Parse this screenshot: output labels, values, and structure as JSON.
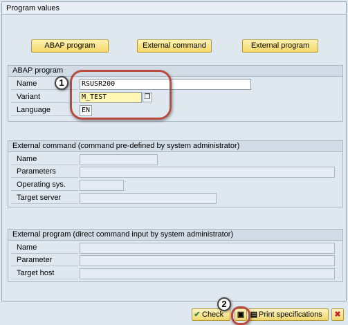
{
  "window": {
    "title": "Program values"
  },
  "buttons": {
    "abap_program": "ABAP program",
    "external_command": "External command",
    "external_program": "External program"
  },
  "abap_group": {
    "title": "ABAP program",
    "name_label": "Name",
    "name_value": "RSUSR200",
    "variant_label": "Variant",
    "variant_value": "M_TEST",
    "language_label": "Language",
    "language_value": "EN"
  },
  "ext_command_group": {
    "title": "External command (command pre-defined by system administrator)",
    "name_label": "Name",
    "parameters_label": "Parameters",
    "os_label": "Operating sys.",
    "target_server_label": "Target server"
  },
  "ext_program_group": {
    "title": "External program (direct command input by system administrator)",
    "name_label": "Name",
    "parameter_label": "Parameter",
    "target_host_label": "Target host"
  },
  "callouts": {
    "one": "1",
    "two": "2"
  },
  "toolbar": {
    "check_label": "Check",
    "save_icon": "save-icon",
    "print_label": "Print specifications",
    "cancel_icon": "cancel-icon"
  },
  "colors": {
    "accent": "#f4d86a",
    "callout": "#b84a3f",
    "cancel": "#c0282d",
    "check": "#2e8b3a"
  }
}
